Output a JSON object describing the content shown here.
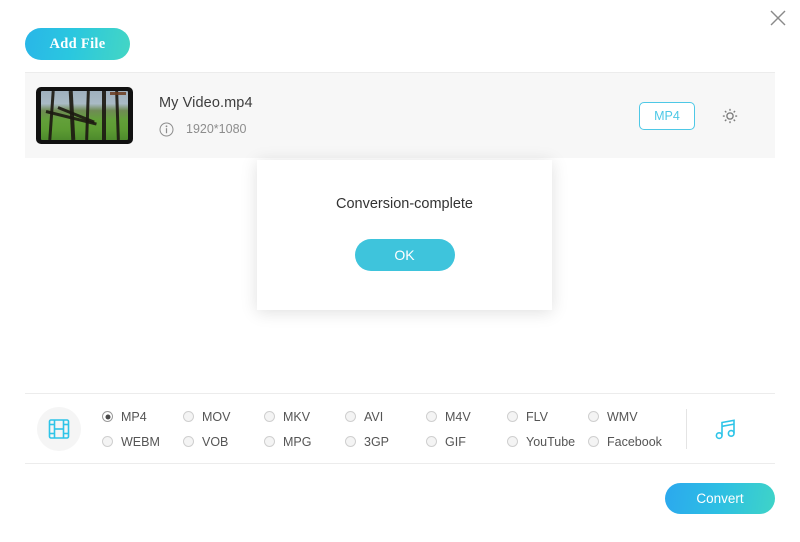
{
  "window": {
    "close_label": "close-icon"
  },
  "toolbar": {
    "add_file_label": "Add File"
  },
  "file_list": {
    "rows": [
      {
        "name": "My Video.mp4",
        "resolution": "1920*1080",
        "format_badge": "MP4",
        "info_icon": "info-icon",
        "settings_icon": "gear-icon",
        "thumbnail": "video-thumbnail"
      }
    ]
  },
  "dialog": {
    "message": "Conversion-complete",
    "ok_label": "OK"
  },
  "format_bar": {
    "video_icon": "film-strip-icon",
    "audio_icon": "music-note-icon",
    "options": [
      {
        "label": "MP4",
        "selected": true
      },
      {
        "label": "MOV",
        "selected": false
      },
      {
        "label": "MKV",
        "selected": false
      },
      {
        "label": "AVI",
        "selected": false
      },
      {
        "label": "M4V",
        "selected": false
      },
      {
        "label": "FLV",
        "selected": false
      },
      {
        "label": "WMV",
        "selected": false
      },
      {
        "label": "WEBM",
        "selected": false
      },
      {
        "label": "VOB",
        "selected": false
      },
      {
        "label": "MPG",
        "selected": false
      },
      {
        "label": "3GP",
        "selected": false
      },
      {
        "label": "GIF",
        "selected": false
      },
      {
        "label": "YouTube",
        "selected": false
      },
      {
        "label": "Facebook",
        "selected": false
      }
    ]
  },
  "footer": {
    "convert_label": "Convert"
  },
  "colors": {
    "accent": "#4ec8e6",
    "accent_dialog": "#3ec4dc",
    "gradient_start": "#29b6e8",
    "gradient_end": "#44d6c4",
    "panel_bg": "#f7f7f7",
    "divider": "#ececec"
  }
}
